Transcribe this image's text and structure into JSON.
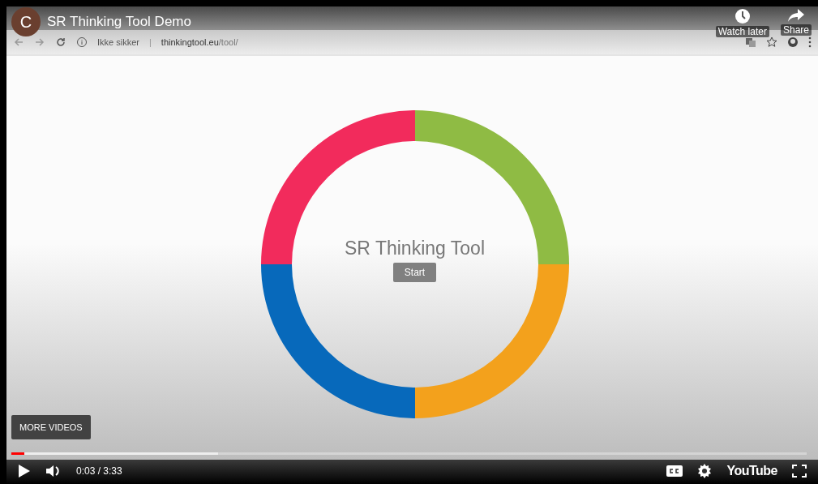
{
  "video_title": {
    "channel_initial": "C",
    "title": "SR Thinking Tool Demo"
  },
  "top_actions": [
    {
      "kind": "watch_later",
      "label": "Watch later"
    },
    {
      "kind": "share",
      "label": "Share"
    }
  ],
  "browser": {
    "security_label": "Ikke sikker",
    "separator": "|",
    "url_host": "thinkingtool.eu",
    "url_path": "/tool/"
  },
  "page": {
    "heading": "SR Thinking Tool",
    "start_button": "Start",
    "ring_segments": [
      {
        "color": "#8fbb44"
      },
      {
        "color": "#f3a11c"
      },
      {
        "color": "#0769bb"
      },
      {
        "color": "#f22b5c"
      }
    ]
  },
  "more_videos": "MORE VIDEOS",
  "player": {
    "played": {
      "level": 0.016
    },
    "buffered": {
      "level": 0.26
    },
    "time": "0:03 / 3:33",
    "logo": "YouTube"
  }
}
